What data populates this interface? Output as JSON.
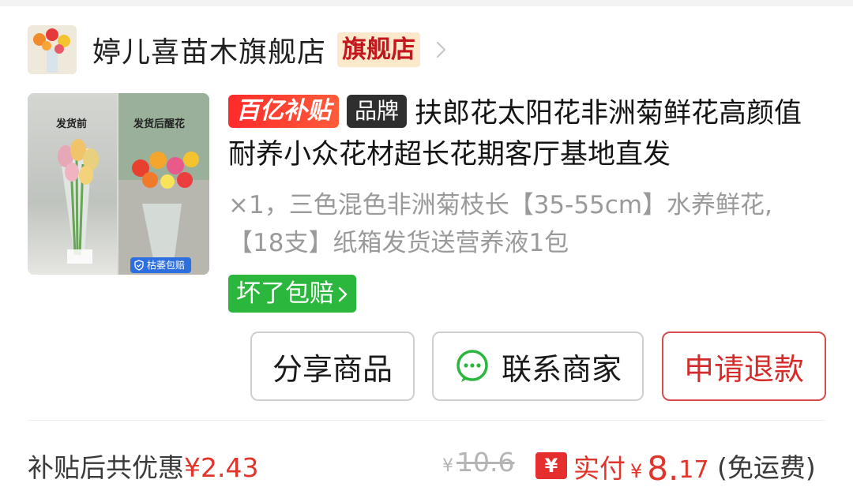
{
  "store": {
    "name": "婷儿喜苗木旗舰店",
    "badge": "旗舰店"
  },
  "product": {
    "image_caption_left": "发货前",
    "image_caption_right": "发货后醒花",
    "image_badge": "枯萎包赔",
    "tag_subsidy": "百亿补贴",
    "tag_brand": "品牌",
    "title": "扶郎花太阳花非洲菊鲜花高颜值耐养小众花材超长花期客厅基地直发",
    "spec": "×1，三色混色非洲菊枝长【35-55cm】水养鲜花,【18支】纸箱发货送营养液1包",
    "promise_tag": "坏了包赔"
  },
  "actions": {
    "share": "分享商品",
    "contact": "联系商家",
    "refund": "申请退款"
  },
  "summary": {
    "discount_label": "补贴后共优惠",
    "discount_amount": "¥2.43",
    "original_yen": "¥",
    "original_price": "10.6",
    "paid_icon": "¥",
    "paid_label": "实付",
    "paid_yen": "¥",
    "paid_int": "8.",
    "paid_dec": "17",
    "shipping": "(免运费)"
  },
  "colors": {
    "accent_red": "#e0352b",
    "promise_green": "#2bb63d",
    "flag_badge_bg": "#fce9cc"
  }
}
